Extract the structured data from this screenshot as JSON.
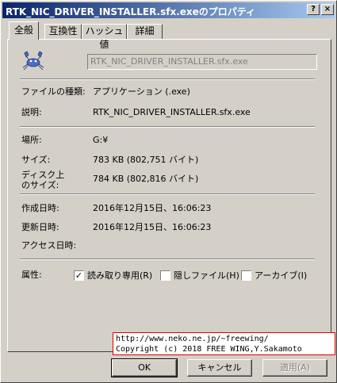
{
  "window": {
    "title": "RTK_NIC_DRIVER_INSTALLER.sfx.exeのプロパティ",
    "help_label": "?",
    "close_label": "×"
  },
  "tabs": [
    {
      "label": "全般"
    },
    {
      "label": "互換性"
    },
    {
      "label": "ハッシュ値"
    },
    {
      "label": "詳細"
    }
  ],
  "general": {
    "file_name": "RTK_NIC_DRIVER_INSTALLER.sfx.exe",
    "file_type_label": "ファイルの種類:",
    "file_type_value": "アプリケーション (.exe)",
    "description_label": "説明:",
    "description_value": "RTK_NIC_DRIVER_INSTALLER.sfx.exe",
    "location_label": "場所:",
    "location_value": "G:¥",
    "size_label": "サイズ:",
    "size_value": "783 KB (802,751 バイト)",
    "size_on_disk_label_1": "ディスク上",
    "size_on_disk_label_2": "のサイズ:",
    "size_on_disk_value": "784 KB (802,816 バイト)",
    "created_label": "作成日時:",
    "created_value": "2016年12月15日、16:06:23",
    "modified_label": "更新日時:",
    "modified_value": "2016年12月15日、16:06:23",
    "accessed_label": "アクセス日時:",
    "accessed_value": "",
    "attributes_label": "属性:",
    "attributes": [
      {
        "label": "読み取り専用(R)",
        "checked": true,
        "mark": "✓"
      },
      {
        "label": "隠しファイル(H)",
        "checked": false,
        "mark": ""
      },
      {
        "label": "アーカイブ(I)",
        "checked": false,
        "mark": ""
      }
    ]
  },
  "banner": {
    "line1": "http://www.neko.ne.jp/~freewing/",
    "line2": "Copyright (c) 2018 FREE WING,Y.Sakamoto"
  },
  "buttons": {
    "ok": "OK",
    "cancel": "キャンセル",
    "apply": "適用(A)"
  }
}
